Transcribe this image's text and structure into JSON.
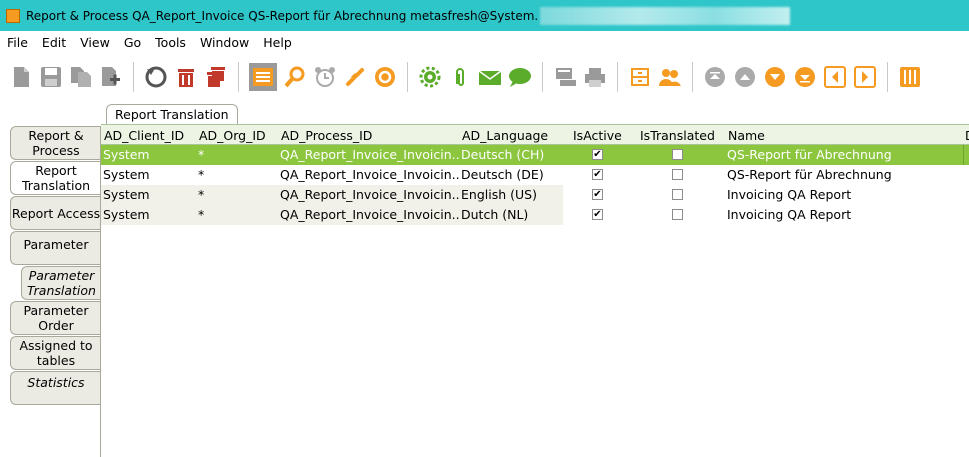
{
  "window": {
    "title": "Report & Process  QA_Report_Invoice  QS-Report für Abrechnung  metasfresh@System."
  },
  "menu": [
    "File",
    "Edit",
    "View",
    "Go",
    "Tools",
    "Window",
    "Help"
  ],
  "tabs": {
    "top": "Report Translation",
    "left": [
      {
        "label": "Report & Process"
      },
      {
        "label": "Report Translation"
      },
      {
        "label": "Report Access"
      },
      {
        "label": "Parameter"
      },
      {
        "label": "Parameter Translation"
      },
      {
        "label": "Parameter Order"
      },
      {
        "label": "Assigned to tables"
      },
      {
        "label": "Statistics"
      }
    ]
  },
  "grid": {
    "columns": [
      "AD_Client_ID",
      "AD_Org_ID",
      "AD_Process_ID",
      "AD_Language",
      "IsActive",
      "IsTranslated",
      "Name",
      "D"
    ],
    "rows": [
      {
        "client": "System",
        "org": "*",
        "process": "QA_Report_Invoice_Invoicin...",
        "language": "Deutsch (CH)",
        "active": true,
        "translated": false,
        "name": "QS-Report für Abrechnung"
      },
      {
        "client": "System",
        "org": "*",
        "process": "QA_Report_Invoice_Invoicin...",
        "language": "Deutsch (DE)",
        "active": true,
        "translated": false,
        "name": "QS-Report für Abrechnung"
      },
      {
        "client": "System",
        "org": "*",
        "process": "QA_Report_Invoice_Invoicin...",
        "language": "English (US)",
        "active": true,
        "translated": false,
        "name": "Invoicing QA Report"
      },
      {
        "client": "System",
        "org": "*",
        "process": "QA_Report_Invoice_Invoicin...",
        "language": "Dutch (NL)",
        "active": true,
        "translated": false,
        "name": "Invoicing QA Report"
      }
    ]
  },
  "colors": {
    "titlebar": "#2ec6c9",
    "selected_row": "#8cc63f",
    "accent_orange": "#f59b22"
  }
}
